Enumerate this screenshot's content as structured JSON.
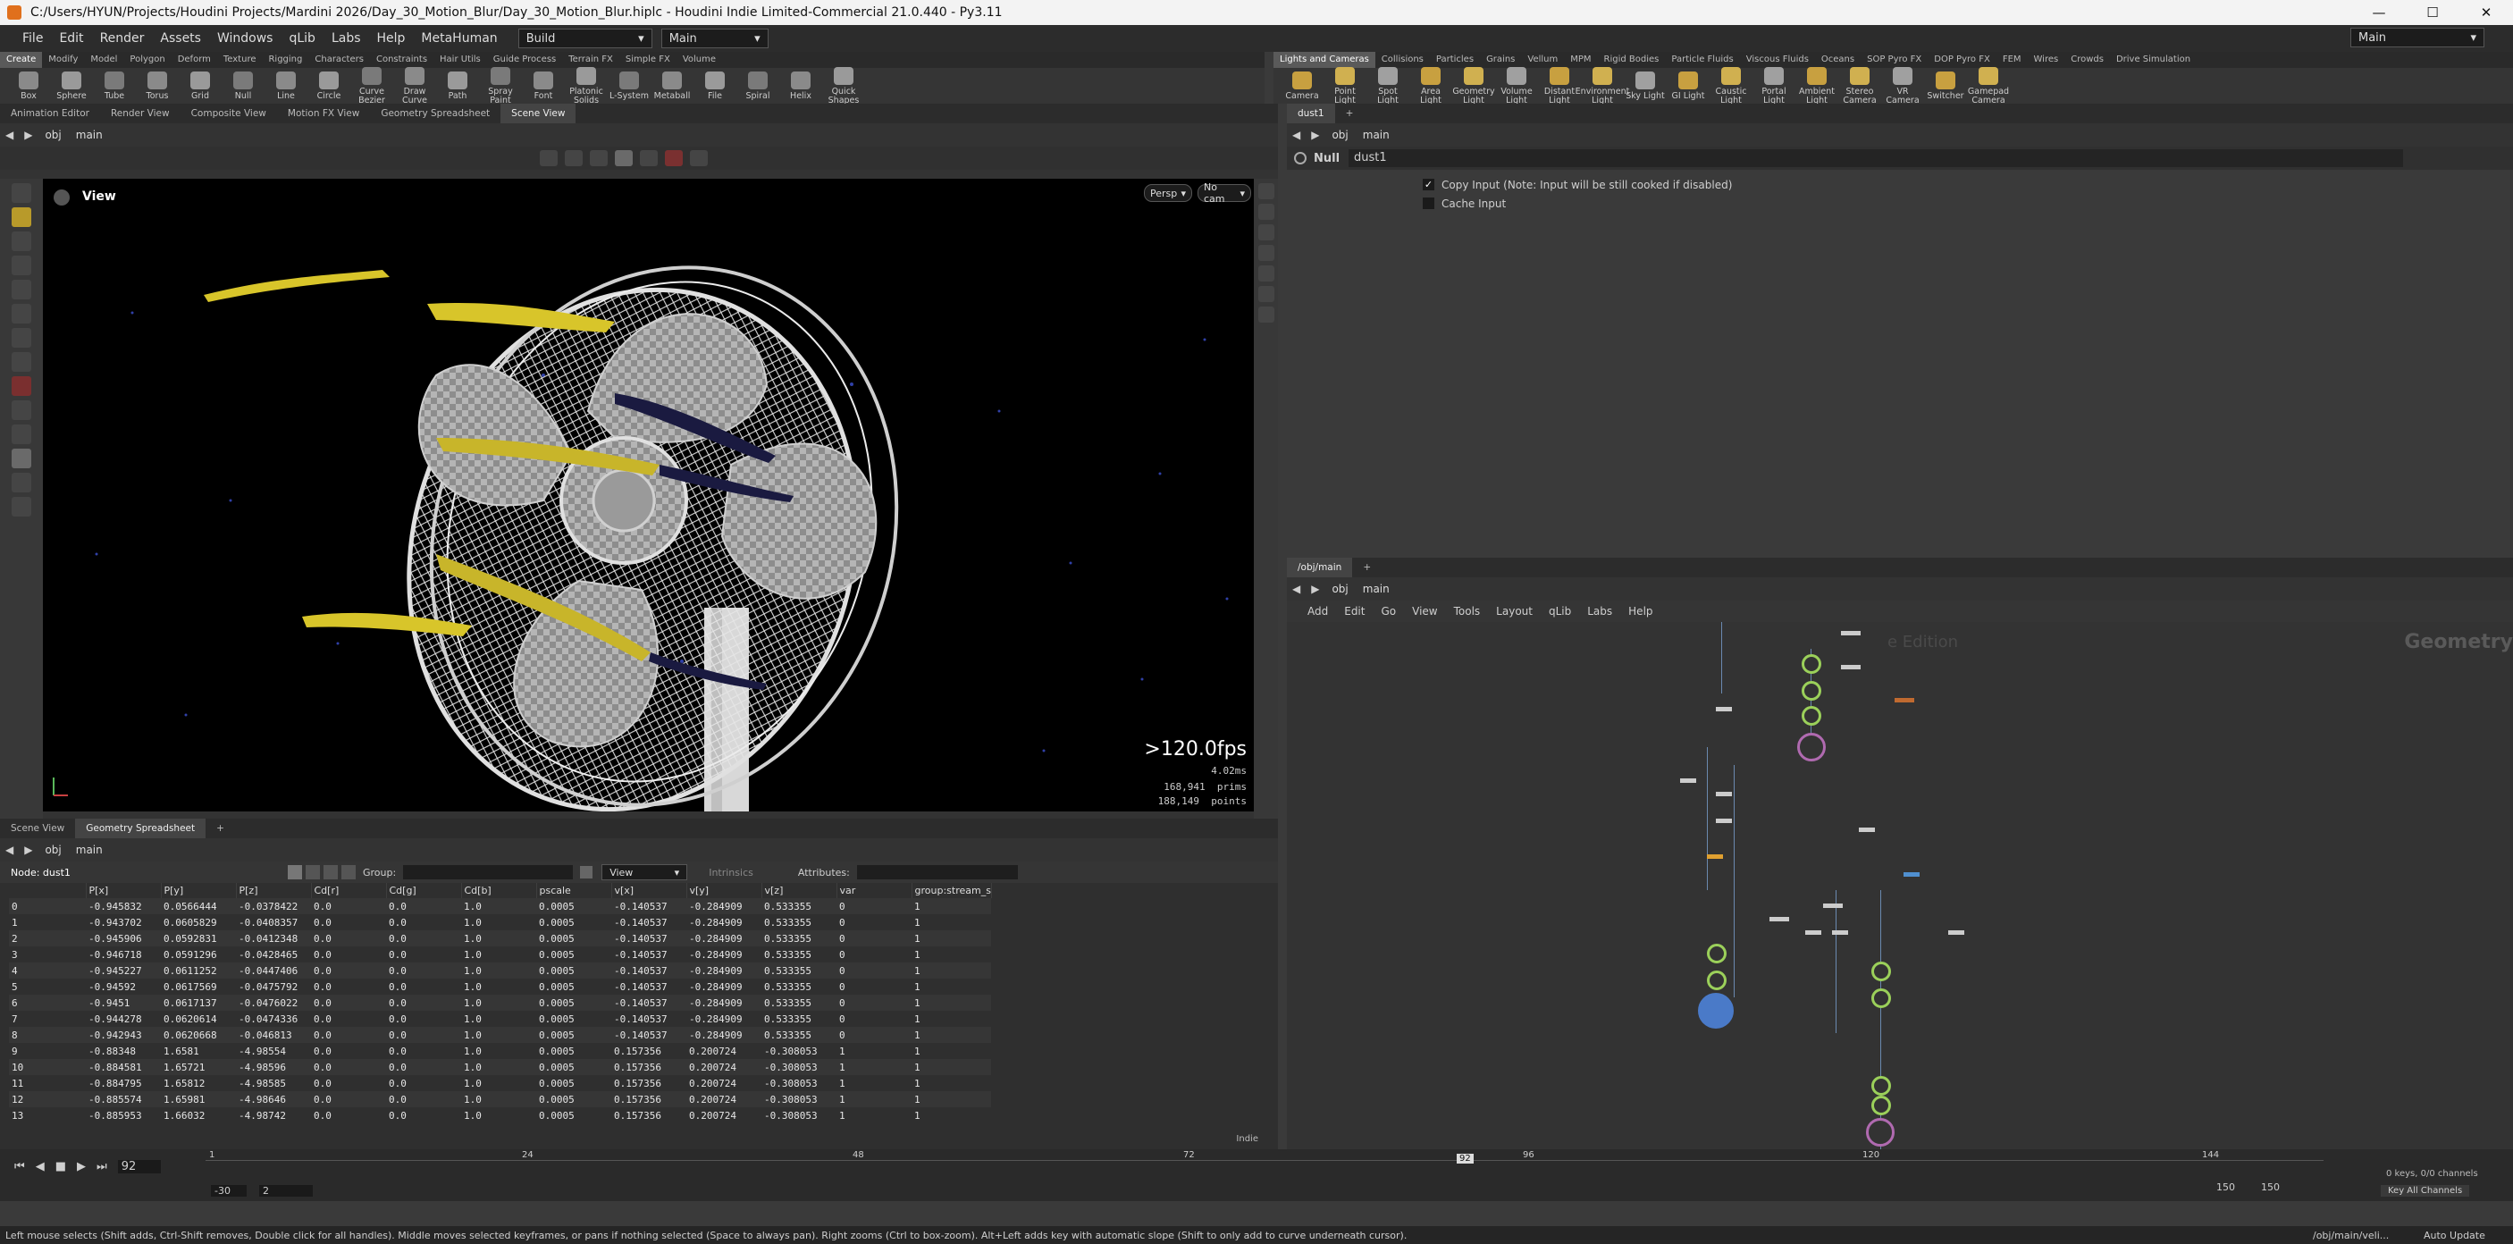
{
  "window": {
    "title": "C:/Users/HYUN/Projects/Houdini Projects/Mardini 2026/Day_30_Motion_Blur/Day_30_Motion_Blur.hiplc - Houdini Indie Limited-Commercial 21.0.440 - Py3.11",
    "min_icon": "minimize-icon",
    "max_icon": "maximize-icon",
    "close_icon": "close-icon"
  },
  "menubar": {
    "items": [
      "File",
      "Edit",
      "Render",
      "Assets",
      "Windows",
      "qLib",
      "Labs",
      "Help",
      "MetaHuman"
    ],
    "desktop": "Build",
    "context": "Main",
    "right_context": "Main"
  },
  "shelf_left": {
    "tabs": [
      "Create",
      "Modify",
      "Model",
      "Polygon",
      "Deform",
      "Texture",
      "Rigging",
      "Characters",
      "Constraints",
      "Hair Utils",
      "Guide Process",
      "Terrain FX",
      "Simple FX",
      "Volume"
    ],
    "tools": [
      "Box",
      "Sphere",
      "Tube",
      "Torus",
      "Grid",
      "Null",
      "Line",
      "Circle",
      "Curve Bezier",
      "Draw Curve",
      "Path",
      "Spray Paint",
      "Font",
      "Platonic Solids",
      "L-System",
      "Metaball",
      "File",
      "Spiral",
      "Helix",
      "Quick Shapes"
    ]
  },
  "shelf_right": {
    "tabs": [
      "Lights and Cameras",
      "Collisions",
      "Particles",
      "Grains",
      "Vellum",
      "MPM",
      "Rigid Bodies",
      "Particle Fluids",
      "Viscous Fluids",
      "Oceans",
      "SOP Pyro FX",
      "DOP Pyro FX",
      "FEM",
      "Wires",
      "Crowds",
      "Drive Simulation"
    ],
    "tools": [
      "Camera",
      "Point Light",
      "Spot Light",
      "Area Light",
      "Geometry Light",
      "Volume Light",
      "Distant Light",
      "Environment Light",
      "Sky Light",
      "GI Light",
      "Caustic Light",
      "Portal Light",
      "Ambient Light",
      "Stereo Camera",
      "VR Camera",
      "Switcher",
      "Gamepad Camera"
    ]
  },
  "viewer": {
    "tabs": [
      "Animation Editor",
      "Render View",
      "Composite View",
      "Motion FX View",
      "Geometry Spreadsheet",
      "Scene View"
    ],
    "active_tab": "Scene View",
    "path": [
      "obj",
      "main"
    ],
    "label": "View",
    "persp": "Persp",
    "cam": "No cam",
    "fps": ">120.0fps",
    "ms": "4.02ms",
    "prims": "168,941  prims",
    "points": "188,149  points"
  },
  "spreadsheet": {
    "tabs": [
      "Scene View",
      "Geometry Spreadsheet"
    ],
    "path": [
      "obj",
      "main"
    ],
    "node_label": "Node: dust1",
    "group_label": "Group:",
    "view_label": "View",
    "intrinsics_label": "Intrinsics",
    "attributes_label": "Attributes:",
    "columns": [
      "",
      "P[x]",
      "P[y]",
      "P[z]",
      "Cd[r]",
      "Cd[g]",
      "Cd[b]",
      "pscale",
      "v[x]",
      "v[y]",
      "v[z]",
      "var",
      "group:stream_s"
    ],
    "rows": [
      [
        "0",
        "-0.945832",
        "0.0566444",
        "-0.0378422",
        "0.0",
        "0.0",
        "1.0",
        "0.0005",
        "-0.140537",
        "-0.284909",
        "0.533355",
        "0",
        "1"
      ],
      [
        "1",
        "-0.943702",
        "0.0605829",
        "-0.0408357",
        "0.0",
        "0.0",
        "1.0",
        "0.0005",
        "-0.140537",
        "-0.284909",
        "0.533355",
        "0",
        "1"
      ],
      [
        "2",
        "-0.945906",
        "0.0592831",
        "-0.0412348",
        "0.0",
        "0.0",
        "1.0",
        "0.0005",
        "-0.140537",
        "-0.284909",
        "0.533355",
        "0",
        "1"
      ],
      [
        "3",
        "-0.946718",
        "0.0591296",
        "-0.0428465",
        "0.0",
        "0.0",
        "1.0",
        "0.0005",
        "-0.140537",
        "-0.284909",
        "0.533355",
        "0",
        "1"
      ],
      [
        "4",
        "-0.945227",
        "0.0611252",
        "-0.0447406",
        "0.0",
        "0.0",
        "1.0",
        "0.0005",
        "-0.140537",
        "-0.284909",
        "0.533355",
        "0",
        "1"
      ],
      [
        "5",
        "-0.94592",
        "0.0617569",
        "-0.0475792",
        "0.0",
        "0.0",
        "1.0",
        "0.0005",
        "-0.140537",
        "-0.284909",
        "0.533355",
        "0",
        "1"
      ],
      [
        "6",
        "-0.9451",
        "0.0617137",
        "-0.0476022",
        "0.0",
        "0.0",
        "1.0",
        "0.0005",
        "-0.140537",
        "-0.284909",
        "0.533355",
        "0",
        "1"
      ],
      [
        "7",
        "-0.944278",
        "0.0620614",
        "-0.0474336",
        "0.0",
        "0.0",
        "1.0",
        "0.0005",
        "-0.140537",
        "-0.284909",
        "0.533355",
        "0",
        "1"
      ],
      [
        "8",
        "-0.942943",
        "0.0620668",
        "-0.046813",
        "0.0",
        "0.0",
        "1.0",
        "0.0005",
        "-0.140537",
        "-0.284909",
        "0.533355",
        "0",
        "1"
      ],
      [
        "9",
        "-0.88348",
        "1.6581",
        "-4.98554",
        "0.0",
        "0.0",
        "1.0",
        "0.0005",
        "0.157356",
        "0.200724",
        "-0.308053",
        "1",
        "1"
      ],
      [
        "10",
        "-0.884581",
        "1.65721",
        "-4.98596",
        "0.0",
        "0.0",
        "1.0",
        "0.0005",
        "0.157356",
        "0.200724",
        "-0.308053",
        "1",
        "1"
      ],
      [
        "11",
        "-0.884795",
        "1.65812",
        "-4.98585",
        "0.0",
        "0.0",
        "1.0",
        "0.0005",
        "0.157356",
        "0.200724",
        "-0.308053",
        "1",
        "1"
      ],
      [
        "12",
        "-0.885574",
        "1.65981",
        "-4.98646",
        "0.0",
        "0.0",
        "1.0",
        "0.0005",
        "0.157356",
        "0.200724",
        "-0.308053",
        "1",
        "1"
      ],
      [
        "13",
        "-0.885953",
        "1.66032",
        "-4.98742",
        "0.0",
        "0.0",
        "1.0",
        "0.0005",
        "0.157356",
        "0.200724",
        "-0.308053",
        "1",
        "1"
      ]
    ],
    "footer": "Indie"
  },
  "parameters": {
    "tab": "dust1",
    "path": [
      "obj",
      "main"
    ],
    "node_type": "Null",
    "node_name": "dust1",
    "copy_input": "Copy Input (Note: Input will be still cooked if disabled)",
    "copy_input_checked": true,
    "cache_input": "Cache Input",
    "cache_input_checked": false
  },
  "network": {
    "tab": "/obj/main",
    "path": [
      "obj",
      "main"
    ],
    "menu": [
      "Add",
      "Edit",
      "Go",
      "View",
      "Tools",
      "Layout",
      "qLib",
      "Labs",
      "Help"
    ],
    "watermark": "Geometry",
    "edition": "e Edition"
  },
  "timeline": {
    "current_frame": "92",
    "marker": "92",
    "ticks": [
      "1",
      "24",
      "48",
      "72",
      "96",
      "120",
      "144"
    ],
    "start": "-30",
    "step": "2",
    "end1": "150",
    "end2": "150",
    "keys": "0 keys, 0/0 channels",
    "key_all": "Key All Channels",
    "auto_update": "Auto Update",
    "path_short": "/obj/main/veli..."
  },
  "status": {
    "text": "Left mouse selects (Shift adds, Ctrl-Shift removes, Double click for all handles). Middle moves selected keyframes, or pans if nothing selected (Space to always pan). Right zooms (Ctrl to box-zoom). Alt+Left adds key with automatic slope (Shift to only add to curve underneath cursor)."
  },
  "colors": {
    "accent_green": "#9bd05a",
    "accent_purple": "#b06ab0",
    "accent_blue": "#4a7ac8",
    "strand_yellow": "#d8c52a"
  }
}
